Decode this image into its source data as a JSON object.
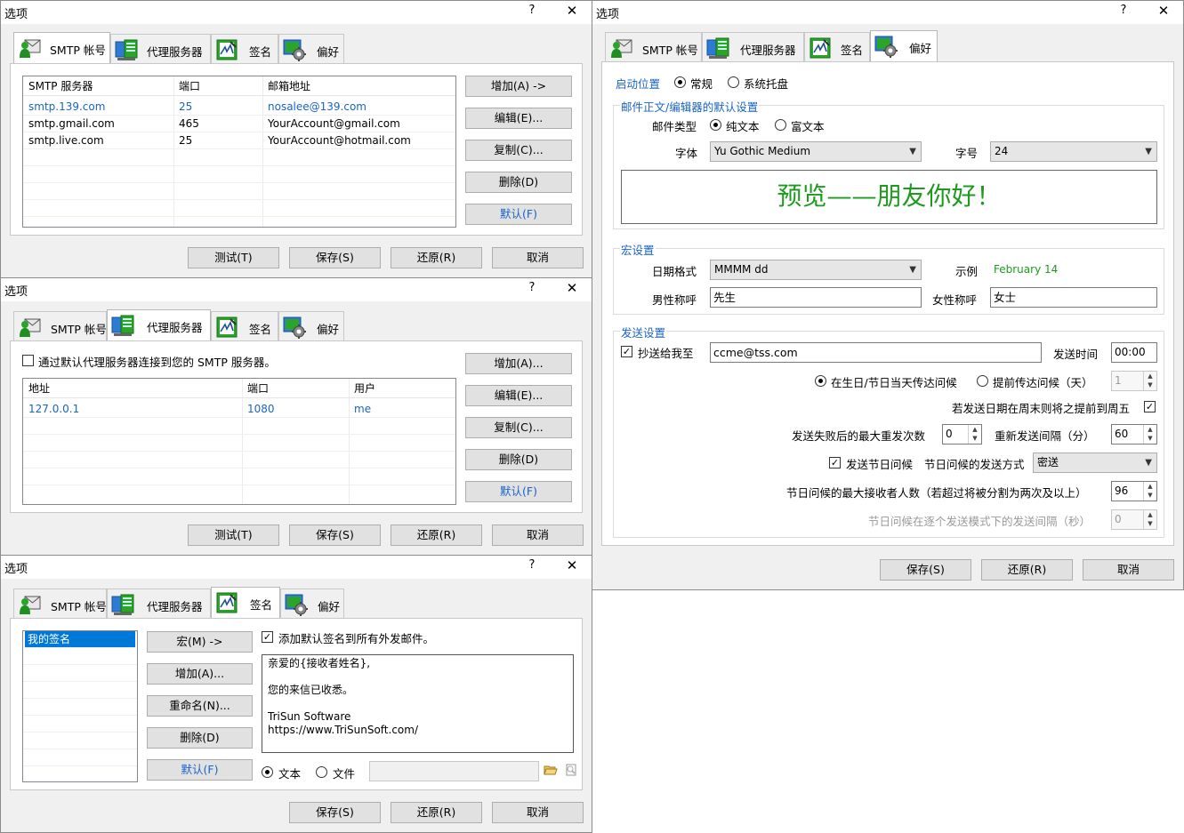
{
  "window_title": "选项",
  "help_glyph": "?",
  "close_glyph": "✕",
  "tabs": {
    "smtp": "SMTP 帐号",
    "proxy": "代理服务器",
    "signature": "签名",
    "prefs": "偏好"
  },
  "footer": {
    "test": "测试(T)",
    "save": "保存(S)",
    "restore": "还原(R)",
    "cancel": "取消"
  },
  "smtp_dialog": {
    "columns": [
      "SMTP 服务器",
      "端口",
      "邮箱地址"
    ],
    "rows": [
      {
        "server": "smtp.139.com",
        "port": "25",
        "email": "nosalee@139.com",
        "default": true
      },
      {
        "server": "smtp.gmail.com",
        "port": "465",
        "email": "YourAccount@gmail.com",
        "default": false
      },
      {
        "server": "smtp.live.com",
        "port": "25",
        "email": "YourAccount@hotmail.com",
        "default": false
      }
    ],
    "buttons": {
      "add": "增加(A) ->",
      "edit": "编辑(E)...",
      "copy": "复制(C)...",
      "delete": "删除(D)",
      "default": "默认(F)"
    }
  },
  "proxy_dialog": {
    "use_proxy_label": "通过默认代理服务器连接到您的 SMTP 服务器。",
    "use_proxy_checked": false,
    "columns": [
      "地址",
      "端口",
      "用户"
    ],
    "rows": [
      {
        "address": "127.0.0.1",
        "port": "1080",
        "user": "me",
        "default": true
      }
    ],
    "buttons": {
      "add": "增加(A)...",
      "edit": "编辑(E)...",
      "copy": "复制(C)...",
      "delete": "删除(D)",
      "default": "默认(F)"
    }
  },
  "signature_dialog": {
    "signatures": [
      "我的签名"
    ],
    "buttons": {
      "macro": "宏(M) ->",
      "add": "增加(A)...",
      "rename": "重命名(N)...",
      "delete": "删除(D)",
      "default": "默认(F)"
    },
    "add_default_label": "添加默认签名到所有外发邮件。",
    "add_default_checked": true,
    "content_lines": [
      "亲爱的{接收者姓名},",
      "",
      "您的来信已收悉。",
      "",
      "TriSun Software",
      "https://www.TriSunSoft.com/"
    ],
    "mode_text": "文本",
    "mode_file": "文件",
    "selected_mode": "text"
  },
  "prefs_dialog": {
    "startup_label": "启动位置",
    "startup_normal": "常规",
    "startup_tray": "系统托盘",
    "editor_group": "邮件正文/编辑器的默认设置",
    "mail_type_label": "邮件类型",
    "plain_text": "纯文本",
    "rich_text": "富文本",
    "font_label": "字体",
    "font_value": "Yu Gothic Medium",
    "size_label": "字号",
    "size_value": "24",
    "preview_text": "预览——朋友你好！",
    "preview_color": "#1e9b1e",
    "macro_group": "宏设置",
    "date_format_label": "日期格式",
    "date_format_value": "MMMM dd",
    "example_label": "示例",
    "example_value": "February 14",
    "male_label": "男性称呼",
    "male_value": "先生",
    "female_label": "女性称呼",
    "female_value": "女士",
    "send_group": "发送设置",
    "cc_label": "抄送给我至",
    "cc_checked": true,
    "cc_value": "ccme@tss.com",
    "send_time_label": "发送时间",
    "send_time_value": "00:00",
    "on_day_label": "在生日/节日当天传达问候",
    "advance_label": "提前传达问候（天）",
    "advance_value": "1",
    "weekend_label": "若发送日期在周末则将之提前到周五",
    "weekend_checked": true,
    "max_retry_label": "发送失败后的最大重发次数",
    "max_retry_value": "0",
    "retry_interval_label": "重新发送间隔（分）",
    "retry_interval_value": "60",
    "send_greet_label": "发送节日问候",
    "send_greet_checked": true,
    "greet_method_label": "节日问候的发送方式",
    "greet_method_value": "密送",
    "max_recipients_label": "节日问候的最大接收者人数（若超过将被分割为两次及以上）",
    "max_recipients_value": "96",
    "send_interval_label": "节日问候在逐个发送模式下的发送间隔（秒）",
    "send_interval_value": "0"
  },
  "colors": {
    "accent": "#1a63c7",
    "preview_green": "#1e9b1e"
  }
}
